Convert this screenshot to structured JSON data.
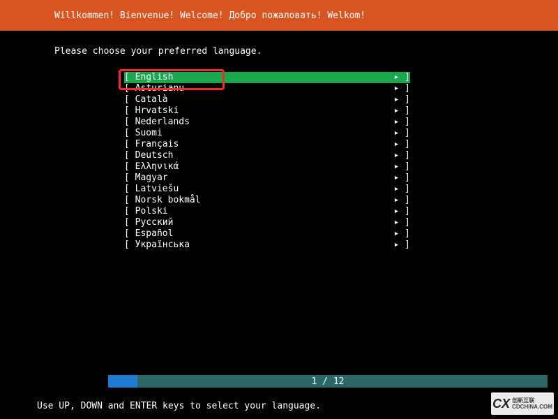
{
  "header": {
    "title": "Willkommen! Bienvenue! Welcome! Добро пожаловать! Welkom!"
  },
  "prompt": "Please choose your preferred language.",
  "languages": [
    {
      "name": "English",
      "selected": true
    },
    {
      "name": "Asturianu",
      "selected": false
    },
    {
      "name": "Català",
      "selected": false
    },
    {
      "name": "Hrvatski",
      "selected": false
    },
    {
      "name": "Nederlands",
      "selected": false
    },
    {
      "name": "Suomi",
      "selected": false
    },
    {
      "name": "Français",
      "selected": false
    },
    {
      "name": "Deutsch",
      "selected": false
    },
    {
      "name": "Ελληνικά",
      "selected": false
    },
    {
      "name": "Magyar",
      "selected": false
    },
    {
      "name": "Latviešu",
      "selected": false
    },
    {
      "name": "Norsk bokmål",
      "selected": false
    },
    {
      "name": "Polski",
      "selected": false
    },
    {
      "name": "Русский",
      "selected": false
    },
    {
      "name": "Español",
      "selected": false
    },
    {
      "name": "Українська",
      "selected": false
    }
  ],
  "arrow": "▸",
  "progress": {
    "label": "1 / 12"
  },
  "footer": {
    "hint": "Use UP, DOWN and ENTER keys to select your language."
  },
  "watermark": {
    "logo": "CX",
    "line1": "创新互联",
    "line2": "CDCHINA.COM"
  }
}
